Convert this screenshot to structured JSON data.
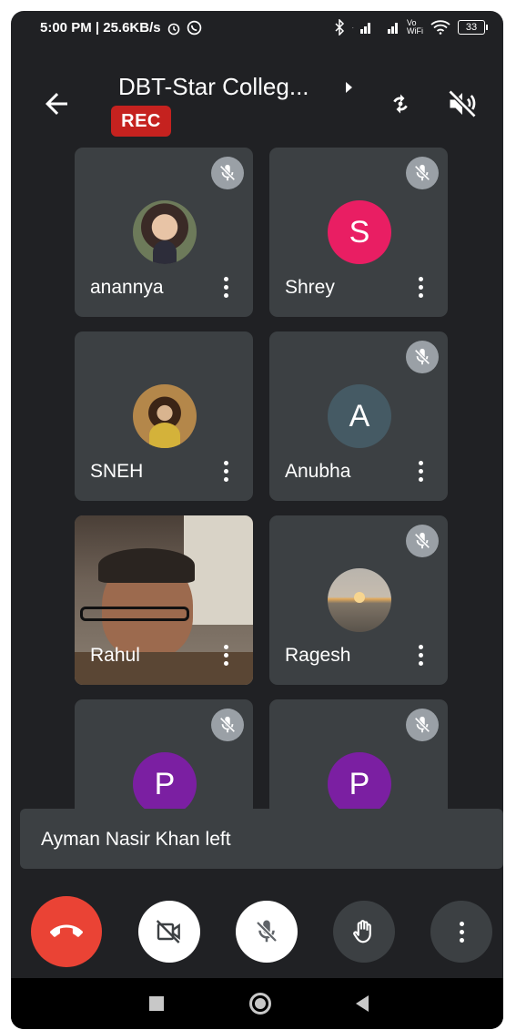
{
  "status_bar": {
    "time_speed": "5:00 PM | 25.6KB/s",
    "network_type": "Vo WiFi",
    "battery": "33"
  },
  "header": {
    "title": "DBT-Star Colleg...",
    "rec_label": "REC"
  },
  "participants": [
    {
      "name": "anannya",
      "avatar_type": "photo",
      "muted": true
    },
    {
      "name": "Shrey",
      "avatar_type": "initial",
      "initial": "S",
      "avatar_color": "#e91e63",
      "muted": true
    },
    {
      "name": "SNEH",
      "avatar_type": "photo",
      "muted": false
    },
    {
      "name": "Anubha",
      "avatar_type": "initial",
      "initial": "A",
      "avatar_color": "#455a64",
      "muted": true
    },
    {
      "name": "Rahul",
      "avatar_type": "video",
      "muted": false
    },
    {
      "name": "Ragesh",
      "avatar_type": "photo",
      "muted": true
    },
    {
      "name": "",
      "avatar_type": "initial",
      "initial": "P",
      "avatar_color": "#7b1fa2",
      "muted": true
    },
    {
      "name": "",
      "avatar_type": "initial",
      "initial": "P",
      "avatar_color": "#7b1fa2",
      "muted": true
    }
  ],
  "toast": {
    "text": "Ayman Nasir Khan left"
  },
  "controls": {
    "icons": [
      "end-call-icon",
      "camera-off-icon",
      "mic-off-icon",
      "raise-hand-icon",
      "more-vert-icon"
    ]
  },
  "colors": {
    "background": "#202124",
    "tile": "#3c4043",
    "end_call": "#ea4335",
    "rec": "#c5221f"
  }
}
